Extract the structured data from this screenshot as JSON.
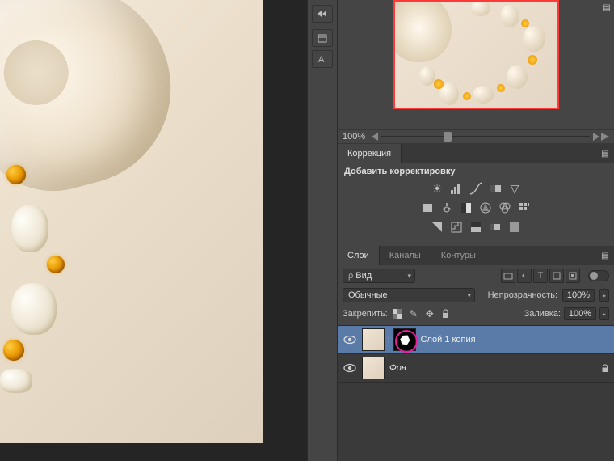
{
  "navigator": {
    "zoom_value": "100%"
  },
  "adjustments_panel": {
    "tab_label": "Коррекция",
    "title": "Добавить корректировку"
  },
  "layers_panel": {
    "tabs": {
      "layers": "Слои",
      "channels": "Каналы",
      "paths": "Контуры"
    },
    "filter_kind": "Вид",
    "blend_mode": "Обычные",
    "opacity_label": "Непрозрачность:",
    "opacity_value": "100%",
    "lock_label": "Закрепить:",
    "fill_label": "Заливка:",
    "fill_value": "100%",
    "layers": [
      {
        "name": "Слой 1 копия"
      },
      {
        "name": "Фон"
      }
    ]
  },
  "icons": {
    "search_prefix": "ρ"
  }
}
